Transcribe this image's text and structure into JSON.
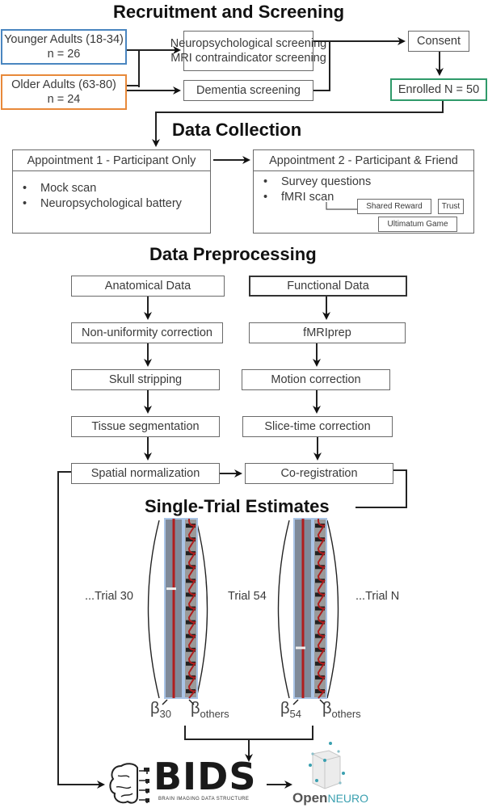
{
  "sections": {
    "recruitment": "Recruitment and Screening",
    "collection": "Data Collection",
    "preprocessing": "Data Preprocessing",
    "single_trial": "Single-Trial Estimates"
  },
  "recruitment": {
    "younger": {
      "label": "Younger Adults (18-34)",
      "n": "n = 26",
      "color": "#4a86c0"
    },
    "older": {
      "label": "Older Adults (63-80)",
      "n": "n = 24",
      "color": "#e8893a"
    },
    "screening1": {
      "line1": "Neuropsychological screening",
      "line2": "MRI contraindicator screening"
    },
    "screening2": "Dementia screening",
    "consent": "Consent",
    "enrolled": {
      "label": "Enrolled N = 50",
      "color": "#2f9a6a"
    }
  },
  "collection": {
    "appointment1": {
      "title": "Appointment 1 - Participant Only",
      "items": [
        "Mock scan",
        "Neuropsychological battery"
      ]
    },
    "appointment2": {
      "title": "Appointment 2 - Participant & Friend",
      "items": [
        "Survey questions",
        "fMRI scan"
      ],
      "tasks": [
        "Shared Reward",
        "Trust",
        "Ultimatum Game"
      ]
    }
  },
  "preprocessing": {
    "anatomical": [
      "Anatomical Data",
      "Non-uniformity correction",
      "Skull stripping",
      "Tissue segmentation",
      "Spatial normalization"
    ],
    "functional": [
      "Functional Data",
      "fMRIprep",
      "Motion correction",
      "Slice-time correction",
      "Co-registration"
    ]
  },
  "single_trial": {
    "labels": [
      "...Trial 30",
      "Trial 54",
      "...Trial N"
    ],
    "beta_left": [
      {
        "symbol": "β",
        "sub": "30"
      },
      {
        "symbol": "β",
        "sub": "others"
      }
    ],
    "beta_right": [
      {
        "symbol": "β",
        "sub": "54"
      },
      {
        "symbol": "β",
        "sub": "others"
      }
    ],
    "matrix_colors": {
      "bar": "#7f8a99",
      "edge": "#a9c4e6",
      "signal": "#b01e1e",
      "tick": "#222222"
    }
  },
  "output": {
    "bids": {
      "title": "BIDS",
      "subtitle": "BRAIN IMAGING DATA STRUCTURE"
    },
    "openneuro": {
      "open": "Open",
      "neuro": "NEURO",
      "accent": "#3aa0b0"
    }
  }
}
